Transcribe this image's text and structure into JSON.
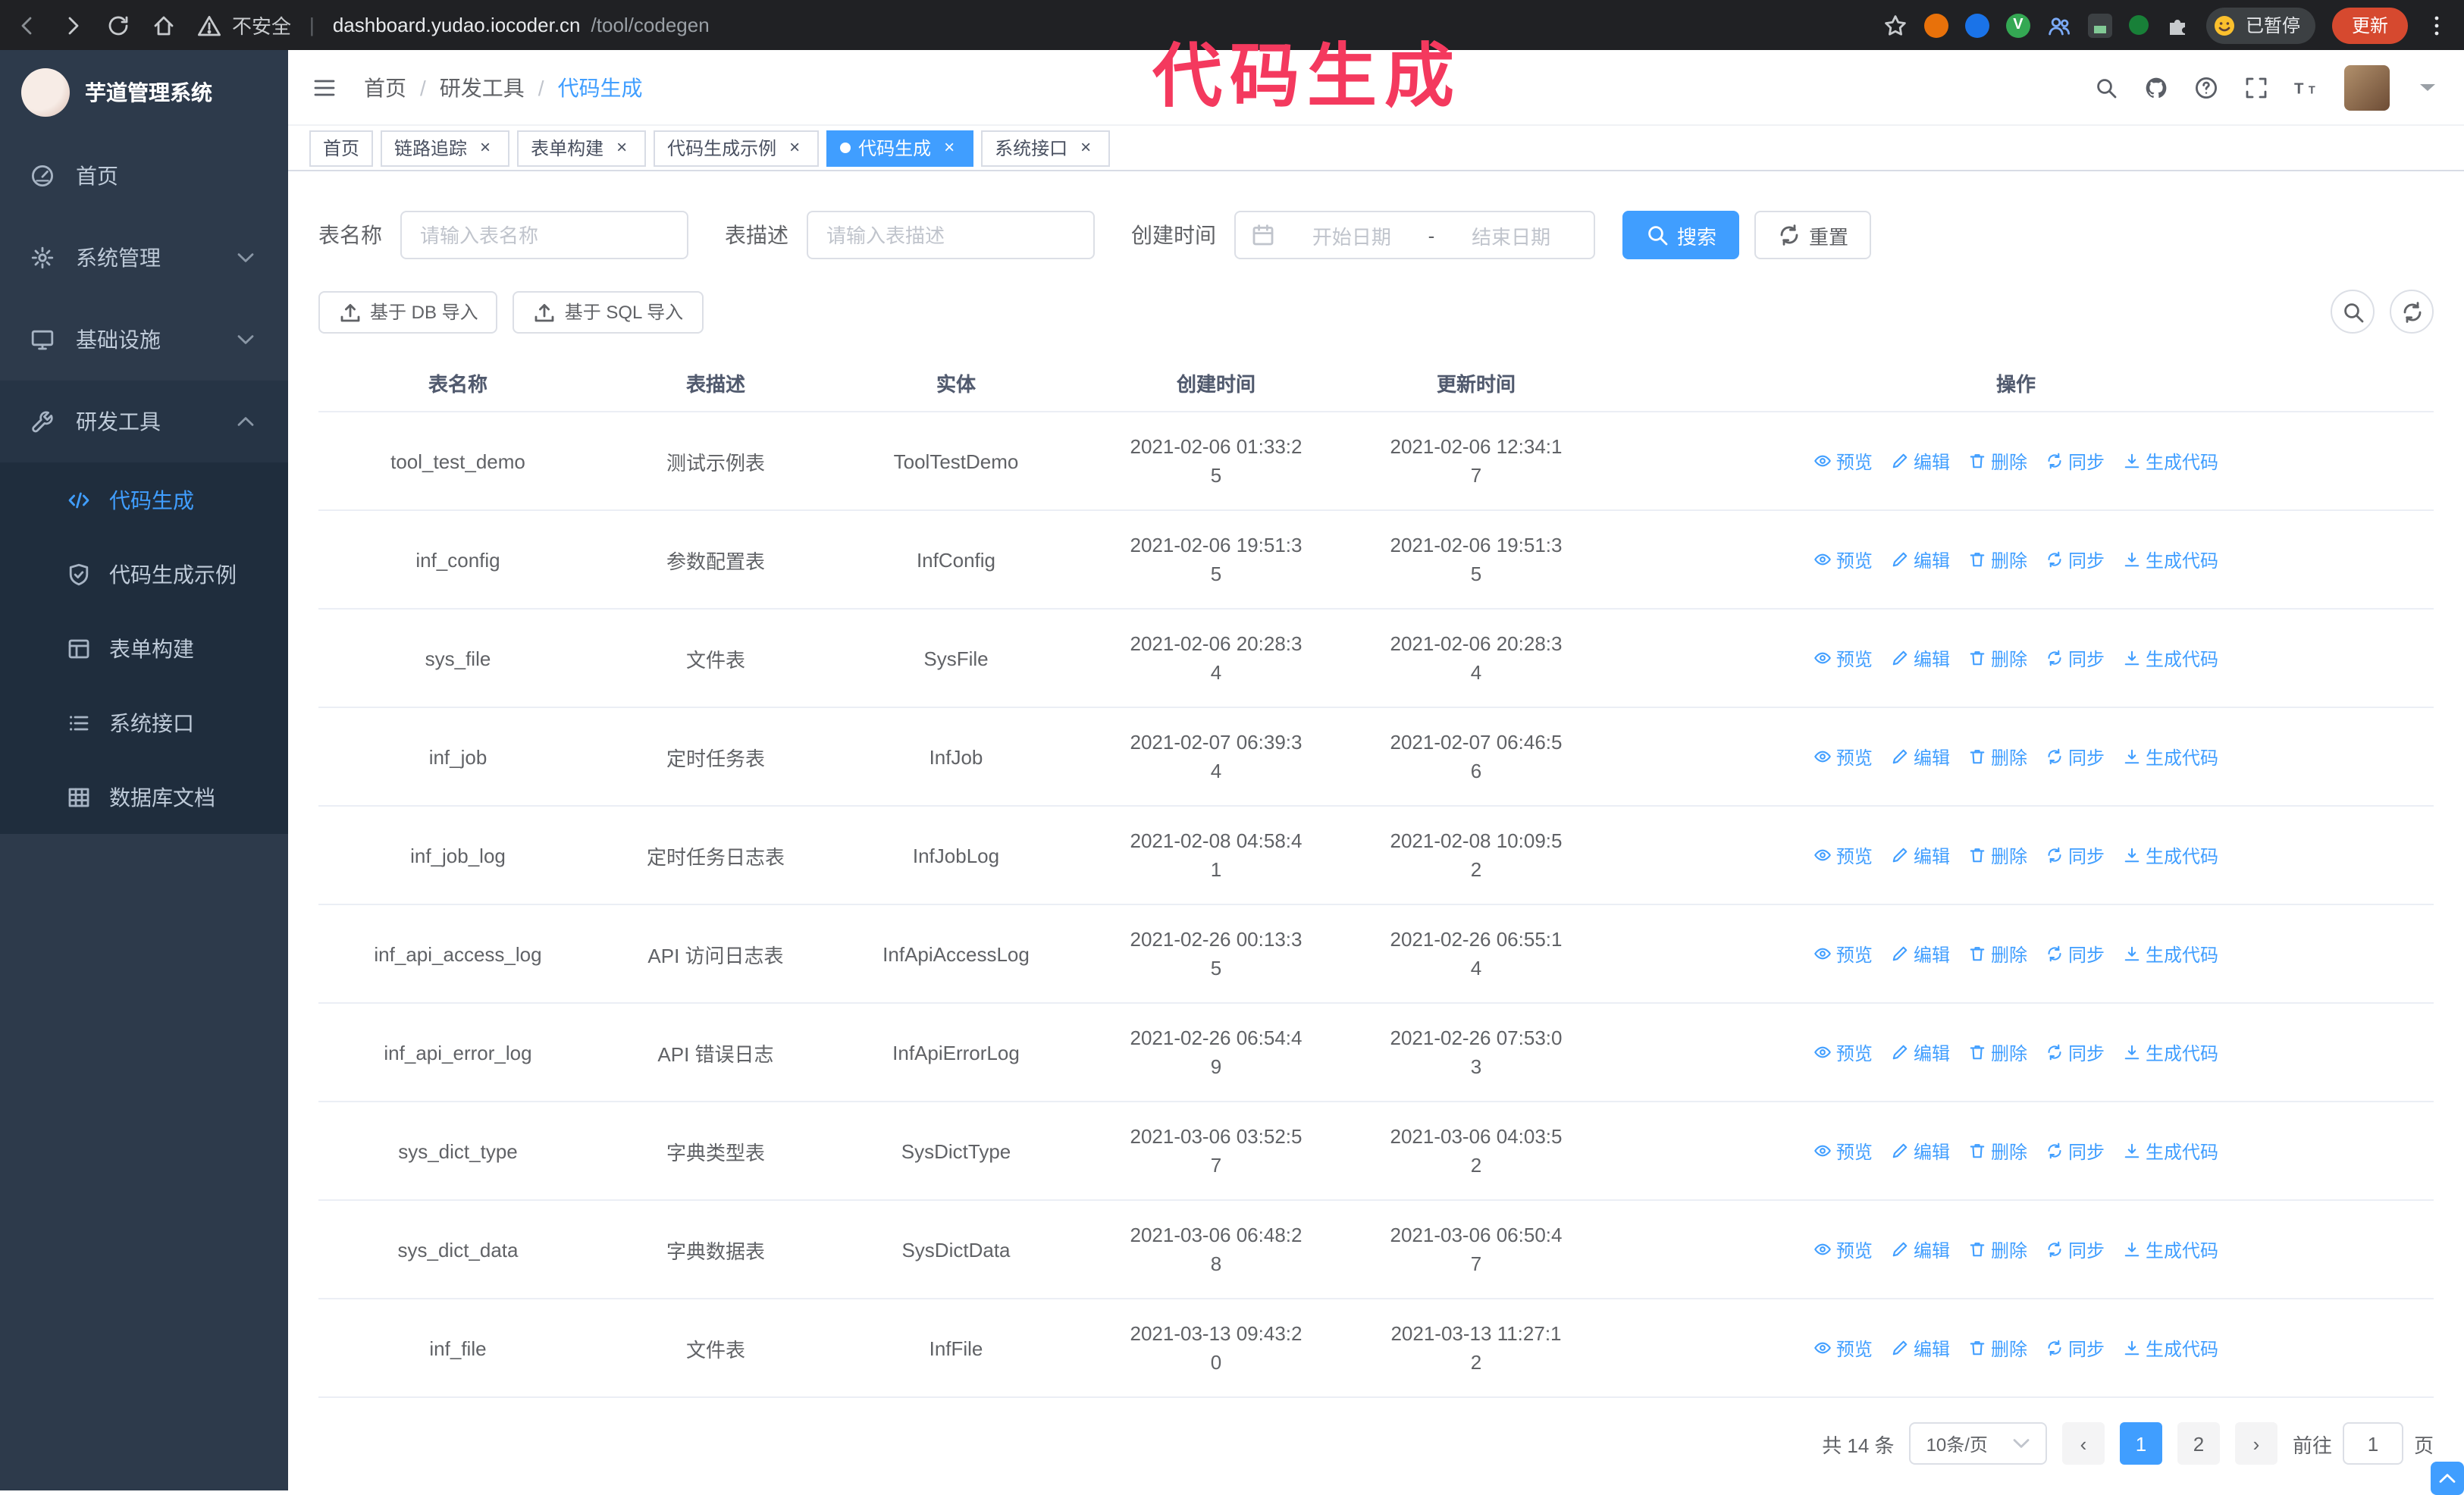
{
  "browser": {
    "security_label": "不安全",
    "url_host": "dashboard.yudao.iocoder.cn",
    "url_path": "/tool/codegen",
    "profile_badge": "已暂停",
    "update_button": "更新"
  },
  "annotation": {
    "text": "代码生成",
    "color": "#f4395e"
  },
  "colors": {
    "primary": "#409eff",
    "sidebar_bg": "#2d3a4b",
    "submenu_bg": "#1f2d3d",
    "update_button": "#d6492f"
  },
  "icons": {
    "close": "×",
    "prev": "‹",
    "next": "›"
  },
  "sidebar": {
    "logo_title": "芋道管理系统",
    "items": [
      {
        "label": "首页"
      },
      {
        "label": "系统管理"
      },
      {
        "label": "基础设施"
      },
      {
        "label": "研发工具",
        "expanded": true
      }
    ],
    "submenu": [
      {
        "label": "代码生成",
        "active": true
      },
      {
        "label": "代码生成示例"
      },
      {
        "label": "表单构建"
      },
      {
        "label": "系统接口"
      },
      {
        "label": "数据库文档"
      }
    ]
  },
  "header": {
    "breadcrumb": [
      "首页",
      "研发工具",
      "代码生成"
    ]
  },
  "tabs": [
    {
      "label": "首页",
      "closable": false,
      "active": false
    },
    {
      "label": "链路追踪",
      "closable": true,
      "active": false
    },
    {
      "label": "表单构建",
      "closable": true,
      "active": false
    },
    {
      "label": "代码生成示例",
      "closable": true,
      "active": false
    },
    {
      "label": "代码生成",
      "closable": true,
      "active": true
    },
    {
      "label": "系统接口",
      "closable": true,
      "active": false
    }
  ],
  "filters": {
    "table_name_label": "表名称",
    "table_name_placeholder": "请输入表名称",
    "table_desc_label": "表描述",
    "table_desc_placeholder": "请输入表描述",
    "create_time_label": "创建时间",
    "date_start_placeholder": "开始日期",
    "date_separator": "-",
    "date_end_placeholder": "结束日期",
    "search_button": "搜索",
    "reset_button": "重置"
  },
  "toolbar": {
    "import_db_button": "基于 DB 导入",
    "import_sql_button": "基于 SQL 导入"
  },
  "table": {
    "columns": [
      "表名称",
      "表描述",
      "实体",
      "创建时间",
      "更新时间",
      "操作"
    ],
    "ops": [
      "预览",
      "编辑",
      "删除",
      "同步",
      "生成代码"
    ],
    "rows": [
      {
        "name": "tool_test_demo",
        "desc": "测试示例表",
        "entity": "ToolTestDemo",
        "created": "2021-02-06 01:33:25",
        "updated": "2021-02-06 12:34:17"
      },
      {
        "name": "inf_config",
        "desc": "参数配置表",
        "entity": "InfConfig",
        "created": "2021-02-06 19:51:35",
        "updated": "2021-02-06 19:51:35"
      },
      {
        "name": "sys_file",
        "desc": "文件表",
        "entity": "SysFile",
        "created": "2021-02-06 20:28:34",
        "updated": "2021-02-06 20:28:34"
      },
      {
        "name": "inf_job",
        "desc": "定时任务表",
        "entity": "InfJob",
        "created": "2021-02-07 06:39:34",
        "updated": "2021-02-07 06:46:56"
      },
      {
        "name": "inf_job_log",
        "desc": "定时任务日志表",
        "entity": "InfJobLog",
        "created": "2021-02-08 04:58:41",
        "updated": "2021-02-08 10:09:52"
      },
      {
        "name": "inf_api_access_log",
        "desc": "API 访问日志表",
        "entity": "InfApiAccessLog",
        "created": "2021-02-26 00:13:35",
        "updated": "2021-02-26 06:55:14"
      },
      {
        "name": "inf_api_error_log",
        "desc": "API 错误日志",
        "entity": "InfApiErrorLog",
        "created": "2021-02-26 06:54:49",
        "updated": "2021-02-26 07:53:03"
      },
      {
        "name": "sys_dict_type",
        "desc": "字典类型表",
        "entity": "SysDictType",
        "created": "2021-03-06 03:52:57",
        "updated": "2021-03-06 04:03:52"
      },
      {
        "name": "sys_dict_data",
        "desc": "字典数据表",
        "entity": "SysDictData",
        "created": "2021-03-06 06:48:28",
        "updated": "2021-03-06 06:50:47"
      },
      {
        "name": "inf_file",
        "desc": "文件表",
        "entity": "InfFile",
        "created": "2021-03-13 09:43:20",
        "updated": "2021-03-13 11:27:12"
      }
    ]
  },
  "pagination": {
    "total_text": "共 14 条",
    "page_size": "10条/页",
    "pages": [
      "1",
      "2"
    ],
    "active_page": "1",
    "goto_label": "前往",
    "goto_value": "1",
    "goto_suffix": "页"
  }
}
